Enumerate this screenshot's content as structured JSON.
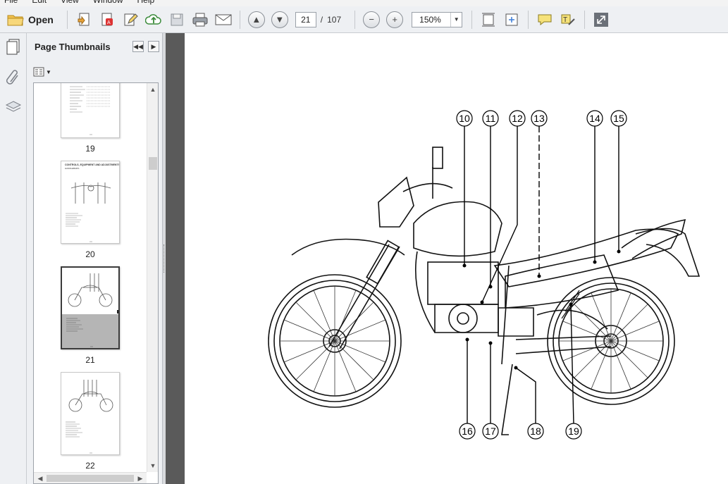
{
  "menu": {
    "items": [
      "File",
      "Edit",
      "View",
      "Window",
      "Help"
    ]
  },
  "toolbar": {
    "open_label": "Open",
    "current_page": "21",
    "page_separator": "/",
    "total_pages": "107",
    "zoom": "150%"
  },
  "sidebar": {
    "title": "Page Thumbnails",
    "thumbnails": [
      {
        "page": "19"
      },
      {
        "page": "20",
        "heading": "CONTROLS, EQUIPMENT AND ADJUSTMENTS",
        "subheading": "HANDLEBARS"
      },
      {
        "page": "21",
        "selected": true
      },
      {
        "page": "22"
      }
    ]
  },
  "document": {
    "callouts": [
      "10",
      "11",
      "12",
      "13",
      "14",
      "15",
      "16",
      "17",
      "18",
      "19"
    ]
  },
  "colors": {
    "toolbar_bg": "#eef0f3",
    "doc_bg": "#5a5a5a",
    "selection_bg": "#b5b5b5"
  }
}
